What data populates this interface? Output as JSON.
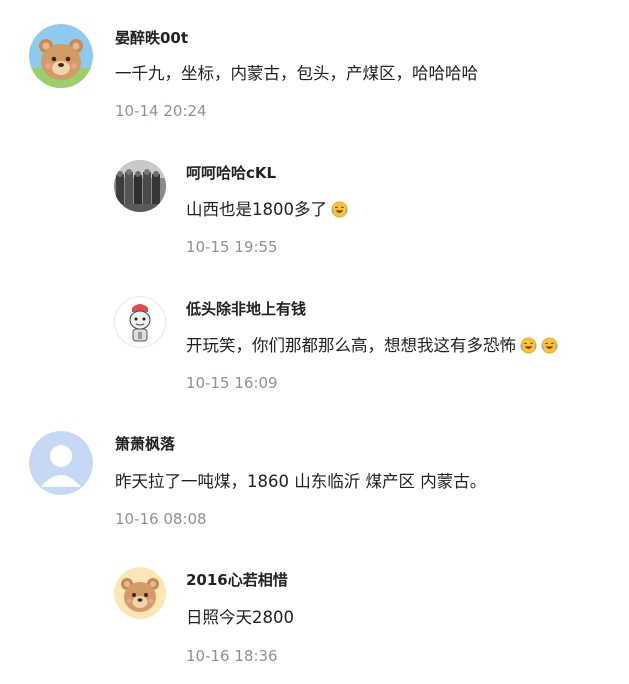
{
  "comments": [
    {
      "level": "top",
      "avatar": "bear-avatar",
      "username": "晏醉昳00t",
      "text": "一千九，坐标，内蒙古，包头，产煤区，哈哈哈哈",
      "time": "10-14 20:24"
    },
    {
      "level": "reply",
      "avatar": "group-photo-avatar",
      "username": "呵呵哈哈cKL",
      "text": "山西也是1800多了",
      "emoji": [
        "laughing-crying-emoji"
      ],
      "time": "10-15 19:55"
    },
    {
      "level": "reply",
      "avatar": "cartoon-figure-avatar",
      "username": "低头除非地上有钱",
      "text": "开玩笑，你们那都那么高，想想我这有多恐怖",
      "emoji": [
        "laughing-crying-emoji",
        "laughing-crying-emoji"
      ],
      "time": "10-15 16:09"
    },
    {
      "level": "top",
      "avatar": "default-user-avatar",
      "username": "箫萧枫落",
      "text": "昨天拉了一吨煤，1860 山东临沂 煤产区 内蒙古。",
      "time": "10-16 08:08"
    },
    {
      "level": "reply",
      "avatar": "bear-avatar",
      "username": "2016心若相惜",
      "text": "日照今天2800",
      "time": "10-16 18:36"
    }
  ],
  "colors": {
    "name": "#222222",
    "text": "#222222",
    "time": "#8f9199",
    "background": "#ffffff"
  }
}
